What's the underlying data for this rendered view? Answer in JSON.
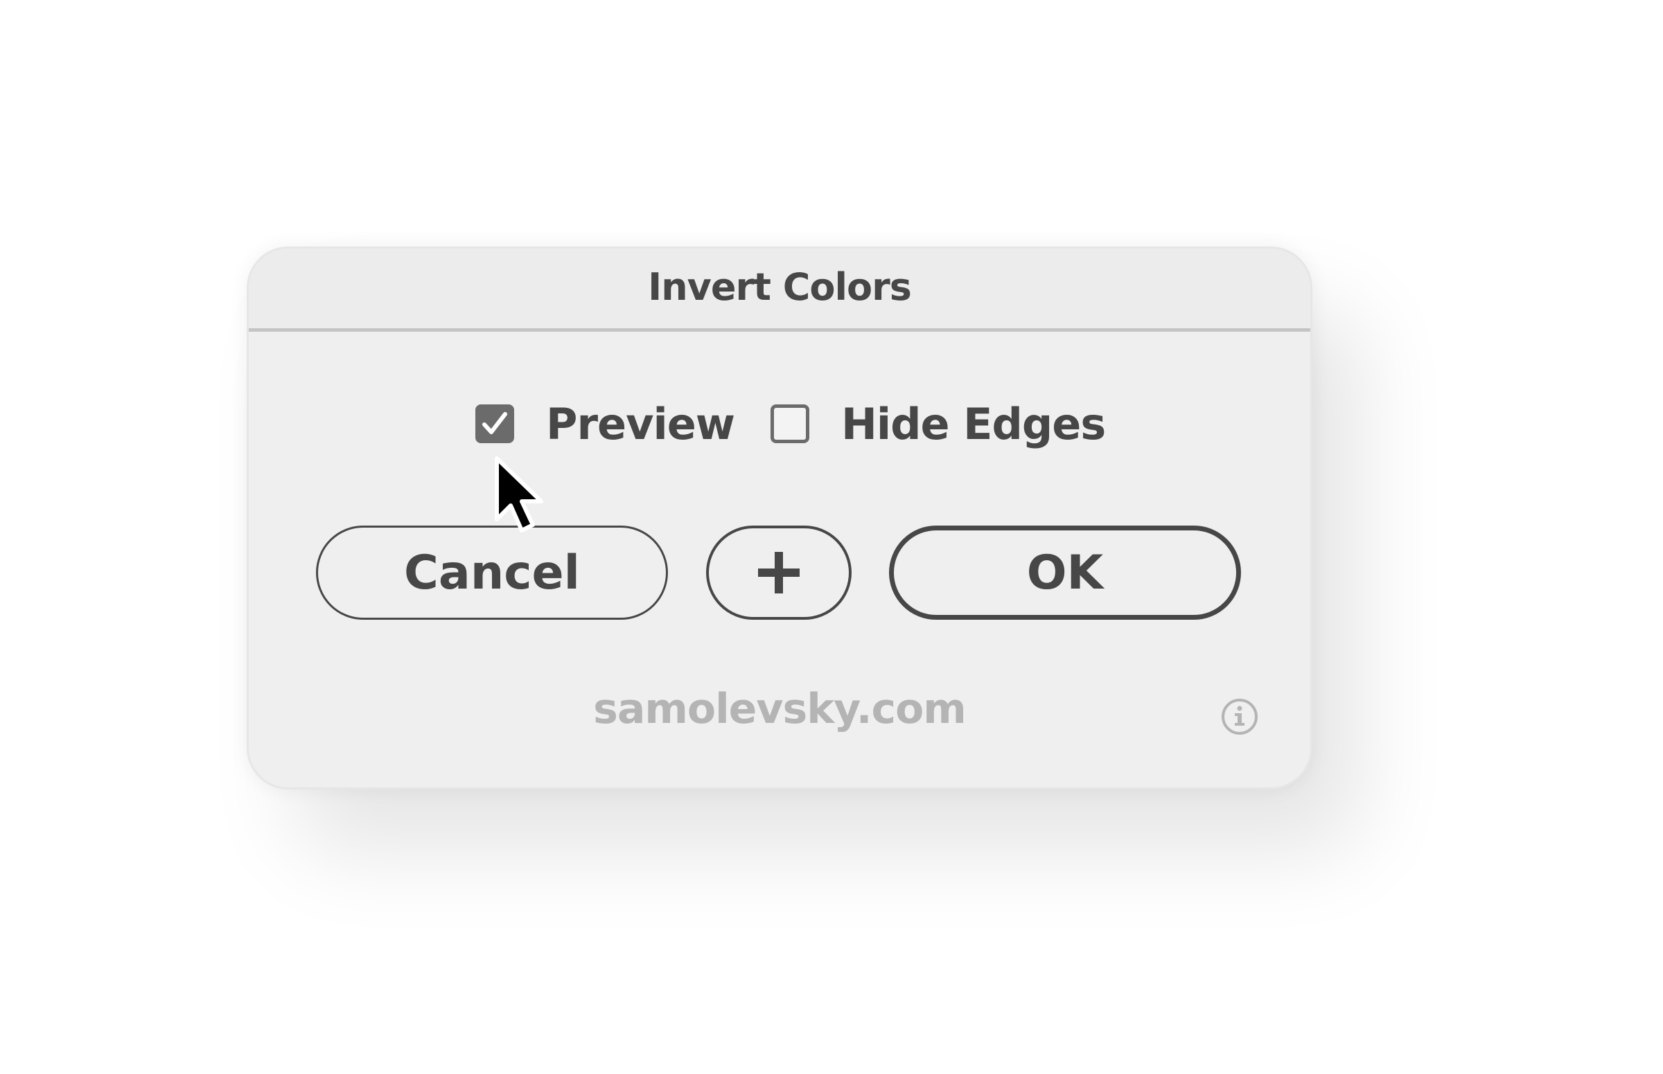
{
  "dialog": {
    "title": "Invert Colors",
    "options": [
      {
        "label": "Preview",
        "checked": true
      },
      {
        "label": "Hide Edges",
        "checked": false
      }
    ],
    "buttons": {
      "cancel_label": "Cancel",
      "add_icon": "plus-icon",
      "ok_label": "OK"
    },
    "footer": {
      "text": "samolevsky.com",
      "info_icon": "info-icon"
    }
  },
  "colors": {
    "dialog_bg": "#efefef",
    "text": "#474747",
    "checkbox_fill": "#6b6b6b",
    "footer_text": "#b4b4b4"
  }
}
